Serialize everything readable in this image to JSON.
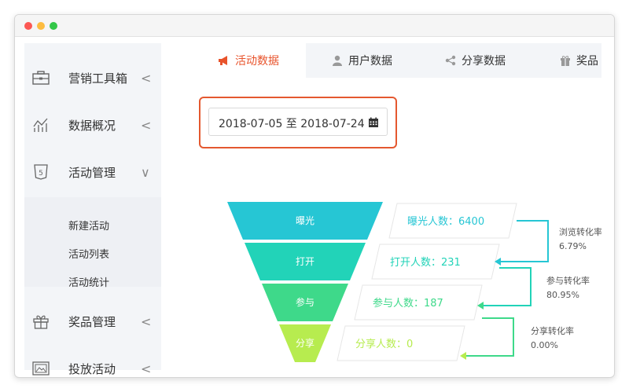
{
  "colors": {
    "accent": "#e8532b",
    "stage1": "#26c6d4",
    "stage2": "#22d3b8",
    "stage3": "#3ed98a",
    "stage4": "#b7ec4f"
  },
  "sidebar": {
    "items": [
      {
        "label": "营销工具箱",
        "icon": "briefcase-icon",
        "caret": "<"
      },
      {
        "label": "数据概况",
        "icon": "chart-line-icon",
        "caret": "<"
      },
      {
        "label": "活动管理",
        "icon": "html5-icon",
        "caret": "∨"
      },
      {
        "label": "奖品管理",
        "icon": "gift-icon",
        "caret": "<"
      },
      {
        "label": "投放活动",
        "icon": "image-icon",
        "caret": "<"
      }
    ],
    "submenu": [
      "新建活动",
      "活动列表",
      "活动统计"
    ]
  },
  "tabs": [
    {
      "label": "活动数据",
      "icon": "megaphone-icon",
      "active": true
    },
    {
      "label": "用户数据",
      "icon": "user-icon",
      "active": false
    },
    {
      "label": "分享数据",
      "icon": "share-icon",
      "active": false
    },
    {
      "label": "奖品",
      "icon": "gift-icon",
      "active": false
    }
  ],
  "date_range": "2018-07-05 至 2018-07-24",
  "funnel": {
    "stages": [
      {
        "name": "曝光",
        "label": "曝光人数：6400"
      },
      {
        "name": "打开",
        "label": "打开人数：231"
      },
      {
        "name": "参与",
        "label": "参与人数：187"
      },
      {
        "name": "分享",
        "label": "分享人数：0"
      }
    ],
    "conversions": [
      {
        "name": "浏览转化率",
        "value": "6.79%"
      },
      {
        "name": "参与转化率",
        "value": "80.95%"
      },
      {
        "name": "分享转化率",
        "value": "0.00%"
      }
    ]
  }
}
